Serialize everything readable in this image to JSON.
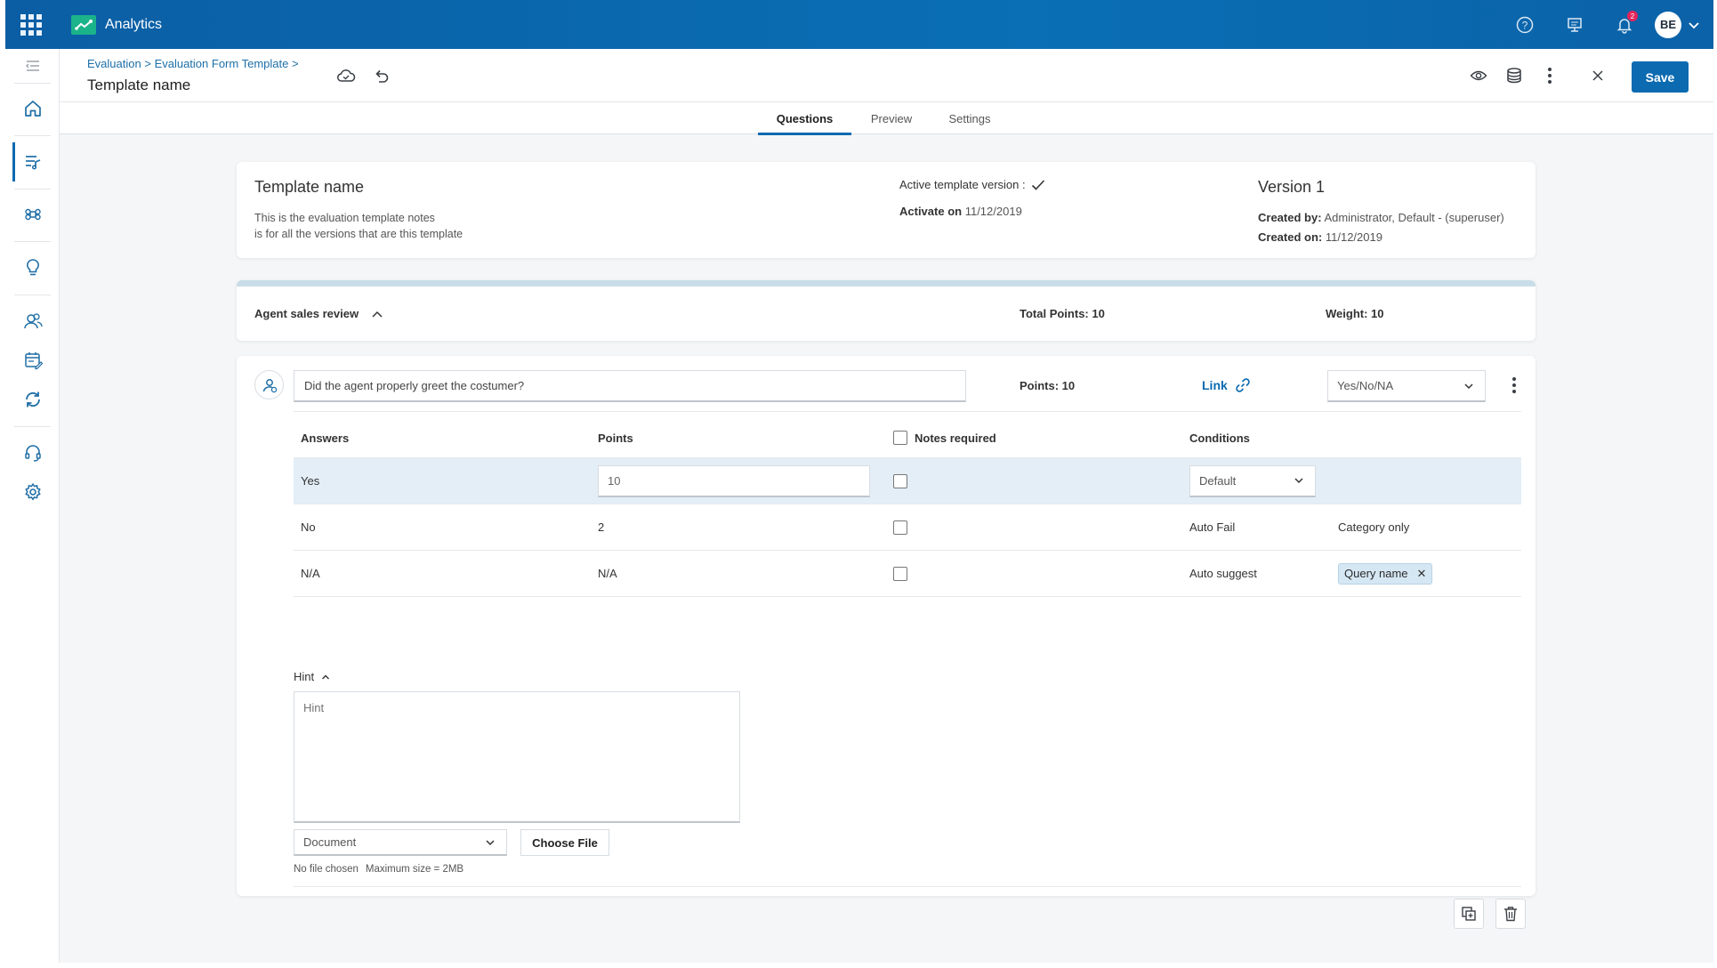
{
  "app": {
    "title": "Analytics",
    "notification_count": "2",
    "user_initials": "BE"
  },
  "header": {
    "breadcrumb": [
      "Evaluation",
      "Evaluation Form Template"
    ],
    "breadcrumb_sep": ">",
    "title": "Template name",
    "save_label": "Save"
  },
  "tabs": [
    {
      "label": "Questions",
      "active": true
    },
    {
      "label": "Preview",
      "active": false
    },
    {
      "label": "Settings",
      "active": false
    }
  ],
  "template_info": {
    "name": "Template name",
    "notes_line1": "This is the evaluation template notes",
    "notes_line2": "is for all the versions that are this template",
    "active_version_label": "Active template version :",
    "activate_on_label": "Activate on",
    "activate_on_value": "11/12/2019",
    "version": "Version 1",
    "created_by_label": "Created by:",
    "created_by_value": "Administrator, Default - (superuser)",
    "created_on_label": "Created on:",
    "created_on_value": "11/12/2019"
  },
  "section": {
    "title": "Agent sales review",
    "total_points": "Total Points: 10",
    "weight": "Weight: 10"
  },
  "question": {
    "text": "Did the agent properly greet the costumer?",
    "points": "Points: 10",
    "link_label": "Link",
    "answer_type": "Yes/No/NA",
    "columns": {
      "answers": "Answers",
      "points": "Points",
      "notes_required": "Notes required",
      "conditions": "Conditions"
    },
    "answers": [
      {
        "answer": "Yes",
        "points": "10",
        "condition": "Default",
        "extra": ""
      },
      {
        "answer": "No",
        "points": "2",
        "condition": "Auto Fail",
        "extra": "Category only"
      },
      {
        "answer": "N/A",
        "points": "N/A",
        "condition": "Auto suggest",
        "extra": "Query name"
      }
    ],
    "hint_label": "Hint",
    "hint_placeholder": "Hint",
    "document_type": "Document",
    "choose_file_label": "Choose File",
    "file_status": "No file chosen",
    "max_size": "Maximum size = 2MB"
  },
  "colors": {
    "topbar": "#0b6ab0",
    "accent": "#0b6ab0",
    "selected_row": "#e3eef7",
    "badge": "#e5245b",
    "logo": "#1bb38a"
  },
  "icons": [
    "apps-grid-icon",
    "analytics-logo-icon",
    "help-icon",
    "presentation-icon",
    "bell-icon",
    "chevron-down-icon",
    "menu-collapse-icon",
    "home-icon",
    "evaluation-icon",
    "command-icon",
    "lightbulb-icon",
    "people-icon",
    "calendar-edit-icon",
    "sync-icon",
    "headset-icon",
    "gear-icon",
    "cloud-icon",
    "undo-icon",
    "eye-icon",
    "layers-icon",
    "more-vertical-icon",
    "close-icon",
    "check-icon",
    "chevron-up-icon",
    "person-question-icon",
    "link-icon",
    "duplicate-icon",
    "trash-icon"
  ]
}
